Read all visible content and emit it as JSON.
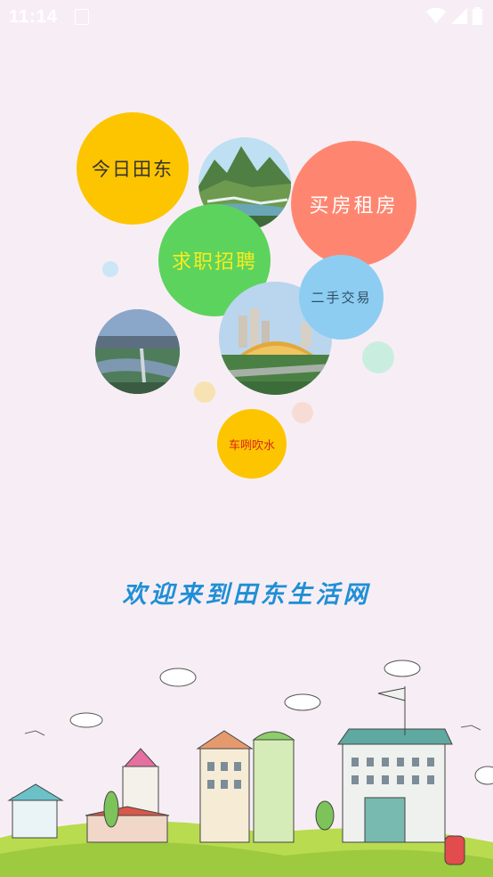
{
  "status_bar": {
    "time": "11:14"
  },
  "bubbles": {
    "today": "今日田东",
    "house": "买房租房",
    "jobs": "求职招聘",
    "second_hand": "二手交易",
    "car_chat": "车咧吹水"
  },
  "welcome": "欢迎来到田东生活网",
  "colors": {
    "today": "#fdc500",
    "house": "#fe8670",
    "jobs": "#5cd35d",
    "second_hand": "#8ecdf2",
    "car_chat": "#fdc500",
    "welcome_text": "#1f8fd6",
    "background": "#f7eef5"
  },
  "icons": [
    "notification-icon",
    "wifi-icon",
    "signal-icon",
    "battery-icon"
  ]
}
